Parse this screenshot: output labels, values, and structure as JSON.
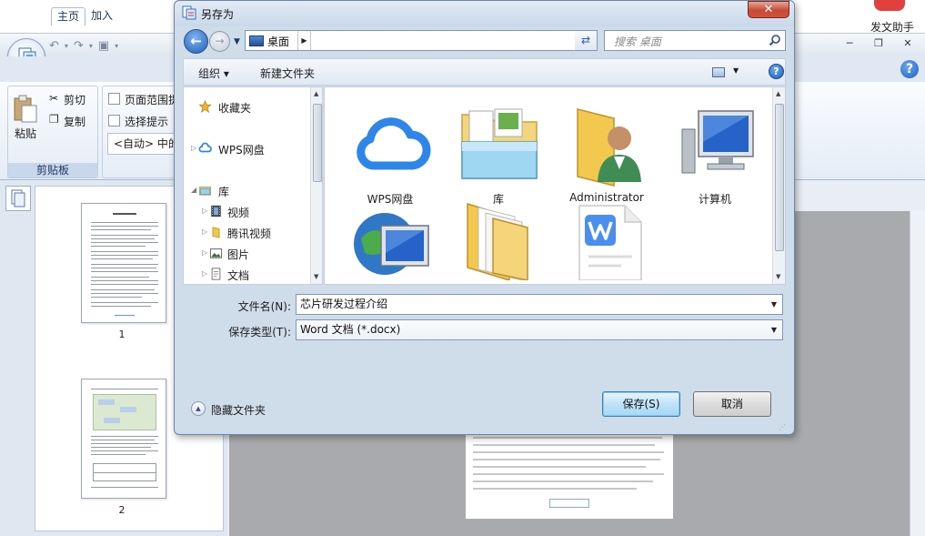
{
  "background_app": {
    "assistant_label": "发文助手",
    "ribbon_tabs": [
      "主页",
      "加入"
    ],
    "clipboard": {
      "paste_label": "粘贴",
      "cut_label": "剪切",
      "copy_label": "复制",
      "group_label": "剪贴板"
    },
    "options": {
      "page_range_label": "页面范围提",
      "select_hint_label": "选择提示",
      "auto_combo_value": "<自动> 中的"
    },
    "thumbnails": [
      {
        "page_number": "1"
      },
      {
        "page_number": "2"
      }
    ],
    "window_controls": {
      "minimize": "─",
      "restore": "❐",
      "close": "✕"
    }
  },
  "dialog": {
    "title": "另存为",
    "close_label": "✕",
    "address": {
      "location": "桌面"
    },
    "search": {
      "placeholder": "搜索 桌面"
    },
    "toolbar": {
      "organize_label": "组织 ▾",
      "new_folder_label": "新建文件夹"
    },
    "nav_items": [
      {
        "label": "收藏夹",
        "icon": "star-icon"
      },
      {
        "label": "WPS网盘",
        "icon": "cloud-icon"
      },
      {
        "label": "库",
        "icon": "library-icon"
      },
      {
        "label": "视频",
        "icon": "video-icon"
      },
      {
        "label": "腾讯视频",
        "icon": "folder-icon"
      },
      {
        "label": "图片",
        "icon": "picture-icon"
      },
      {
        "label": "文档",
        "icon": "document-icon"
      }
    ],
    "files": [
      {
        "label": "WPS网盘",
        "icon": "cloud-icon"
      },
      {
        "label": "库",
        "icon": "library-icon"
      },
      {
        "label": "Administrator",
        "icon": "user-folder-icon"
      },
      {
        "label": "计算机",
        "icon": "computer-icon"
      },
      {
        "label": "",
        "icon": "network-icon"
      },
      {
        "label": "",
        "icon": "folder-icon"
      },
      {
        "label": "",
        "icon": "wps-doc-icon"
      }
    ],
    "filename": {
      "label": "文件名(N):",
      "value": "芯片研发过程介绍"
    },
    "filetype": {
      "label": "保存类型(T):",
      "value": "Word 文档 (*.docx)"
    },
    "hide_folders_label": "隐藏文件夹",
    "save_label": "保存(S)",
    "cancel_label": "取消"
  },
  "colors": {
    "dialog_bg": "#cfdcea",
    "primary_button": "#bfe2f8",
    "close_button": "#c74a35",
    "cloud_blue": "#2f86ea",
    "wps_blue": "#4a8ff0"
  }
}
